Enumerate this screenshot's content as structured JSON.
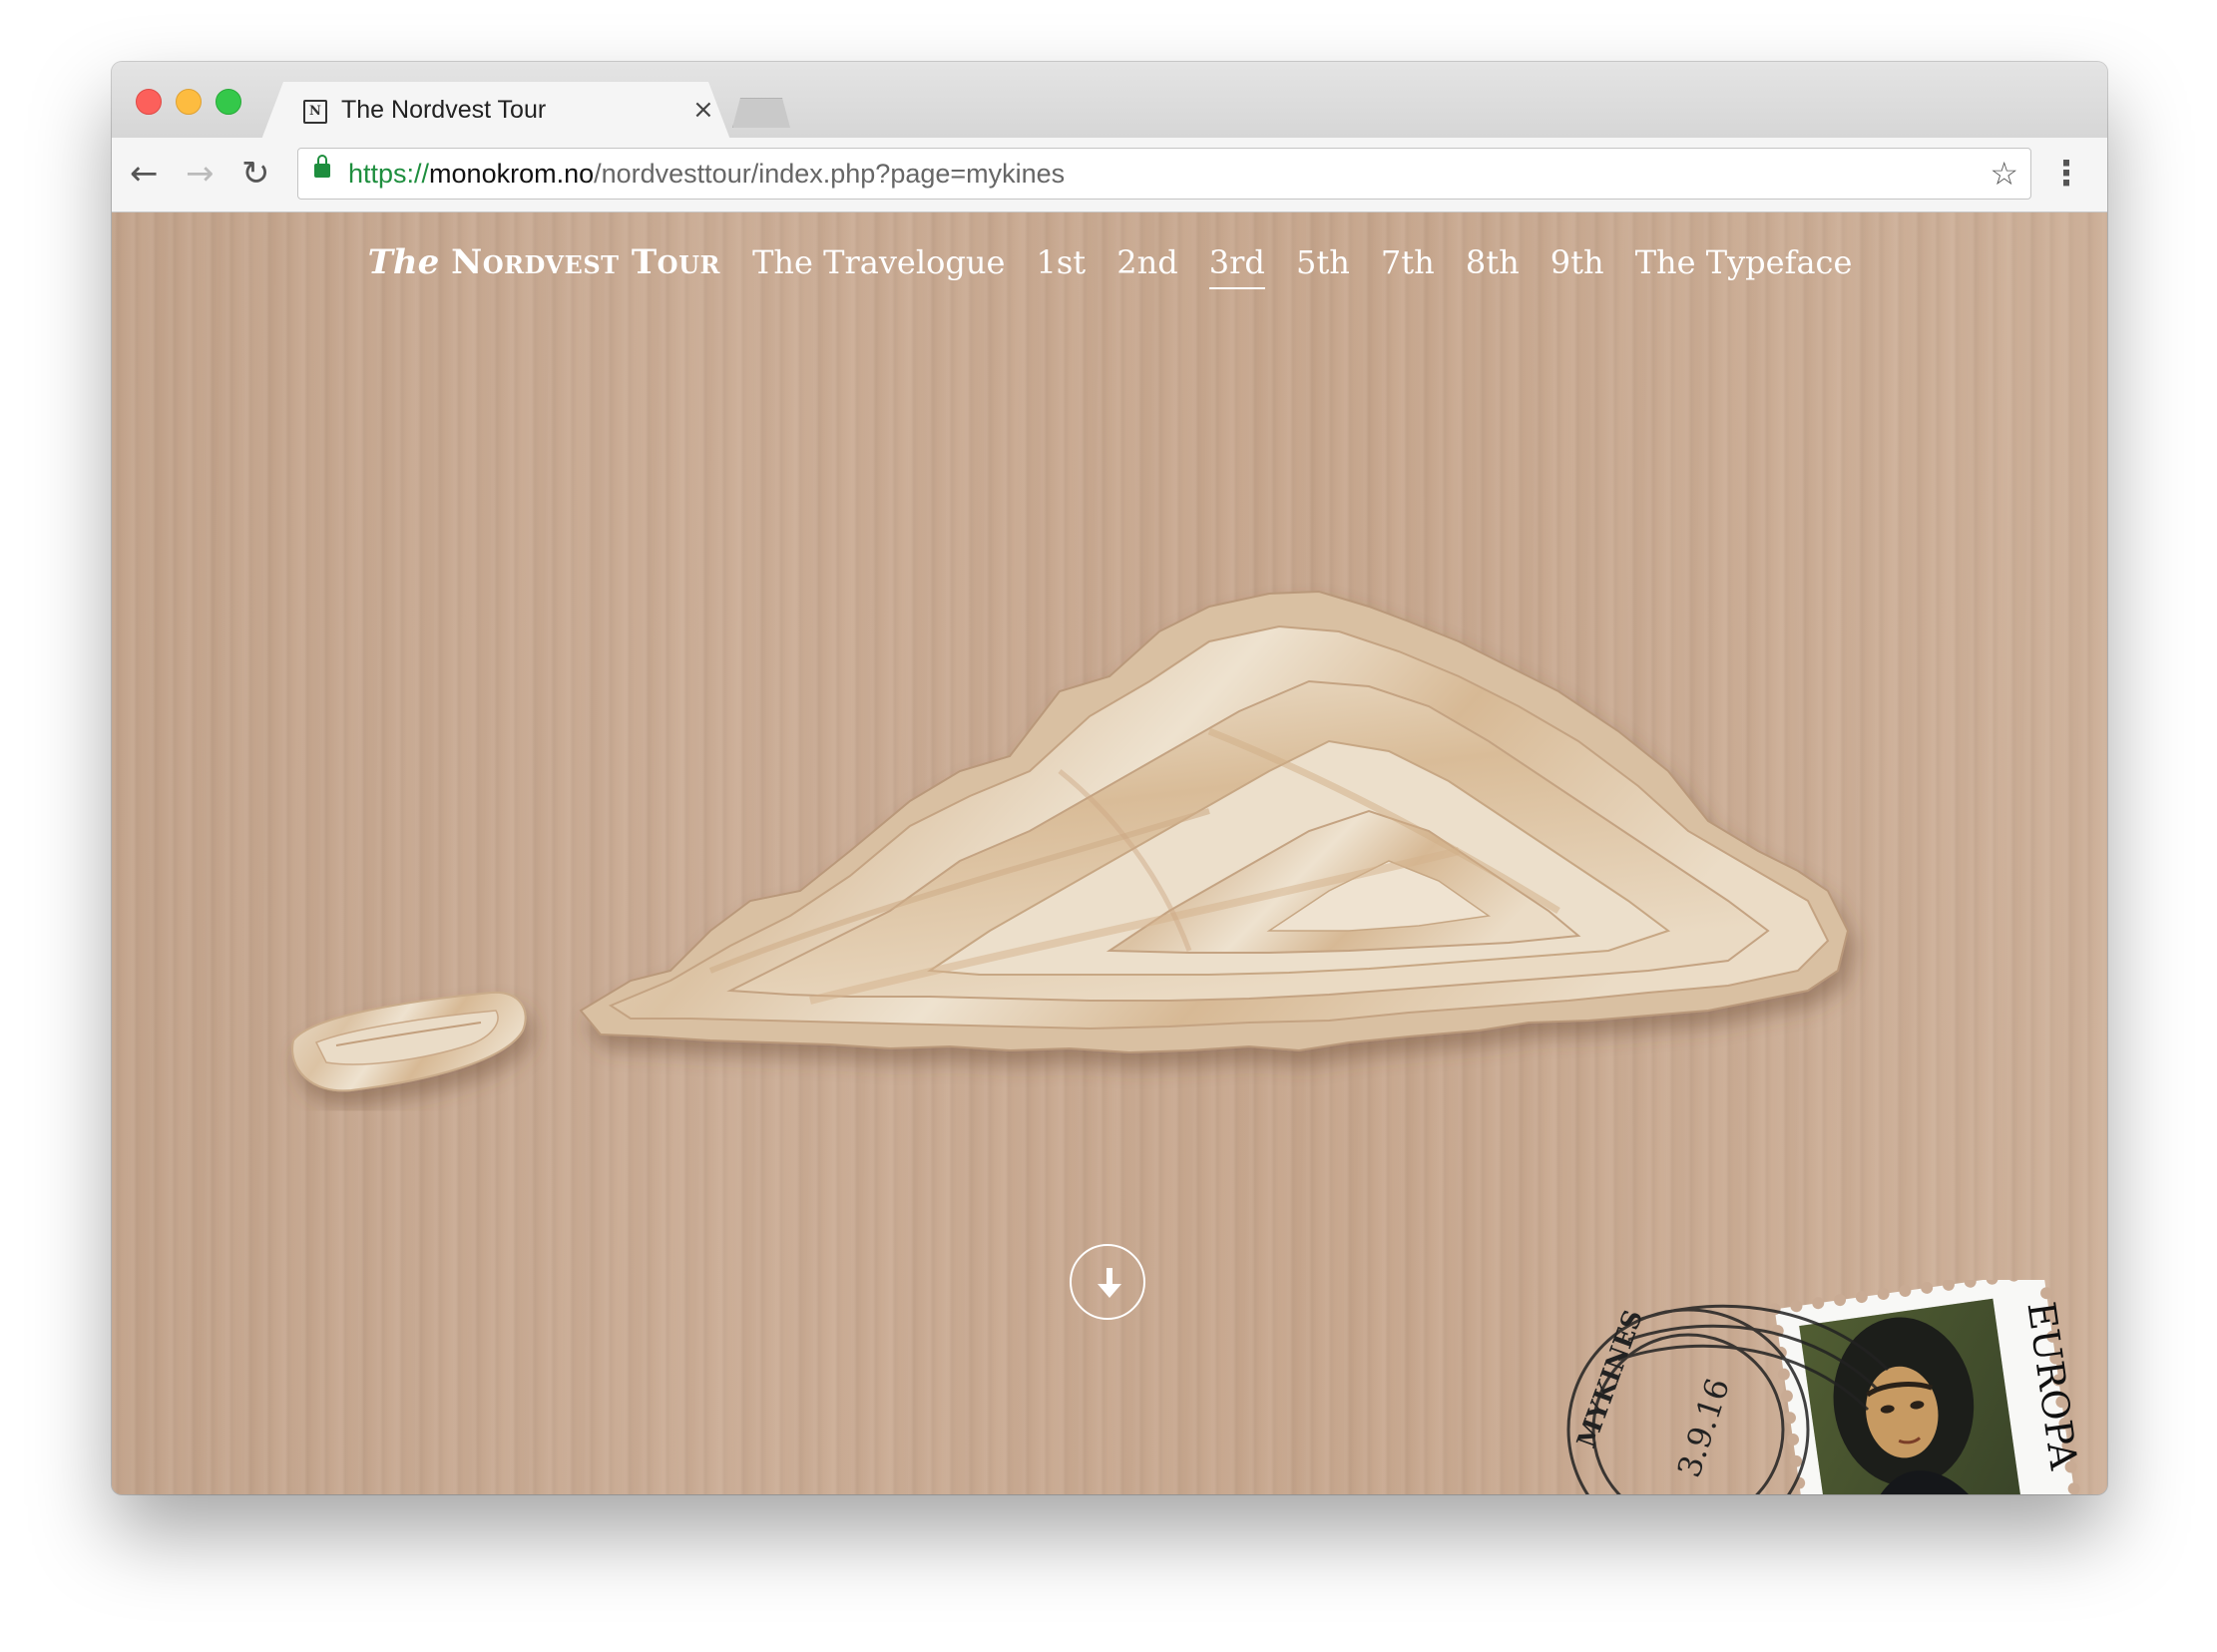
{
  "browser": {
    "tab_title": "The Nordvest Tour",
    "tab_favicon_glyph": "N",
    "tab_close": "×",
    "url_scheme": "https://",
    "url_host": "monokrom.no",
    "url_path": "/nordvesttour/index.php?page=mykines",
    "back_glyph": "←",
    "forward_glyph": "→",
    "reload_glyph": "↻",
    "star_glyph": "☆",
    "menu_glyph": "⋮"
  },
  "site_nav": {
    "brand_the": "The",
    "brand_name": "Nordvest Tour",
    "links": [
      {
        "label": "The Travelogue",
        "active": false
      },
      {
        "label": "1st",
        "active": false
      },
      {
        "label": "2nd",
        "active": false
      },
      {
        "label": "3rd",
        "active": true
      },
      {
        "label": "5th",
        "active": false
      },
      {
        "label": "7th",
        "active": false
      },
      {
        "label": "8th",
        "active": false
      },
      {
        "label": "9th",
        "active": false
      },
      {
        "label": "The Typeface",
        "active": false
      }
    ]
  },
  "stamp": {
    "postmark_place": "MYKINES",
    "postmark_date": "3.9.16",
    "label": "EUROPA"
  },
  "colors": {
    "wood": "#c9ab94",
    "island_light": "#e8d9c4",
    "island_shade": "#b89676",
    "url_green": "#1e8e3e",
    "nav_text": "#ffffff"
  },
  "icons": {
    "scroll": "arrow-down-circle-icon",
    "secure": "lock-icon",
    "bookmark": "star-icon"
  }
}
